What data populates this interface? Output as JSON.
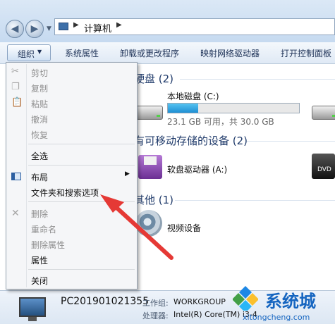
{
  "address": {
    "path": "计算机"
  },
  "toolbar": {
    "organize": "组织",
    "system_properties": "系统属性",
    "uninstall": "卸载或更改程序",
    "map_drive": "映射网络驱动器",
    "open_control_panel": "打开控制面板"
  },
  "groups": {
    "hdd": "硬盘 (2)",
    "removable": "有可移动存储的设备 (2)",
    "other": "其他 (1)"
  },
  "drives": {
    "c_label": "本地磁盘 (C:)",
    "c_free": "23.1 GB 可用，共 30.0 GB",
    "c_used_fraction": 0.23,
    "floppy_label": "软盘驱动器 (A:)",
    "dvd_badge": "DVD",
    "video_label": "视频设备"
  },
  "menu": {
    "cut": "剪切",
    "copy": "复制",
    "paste": "粘贴",
    "undo": "撤消",
    "redo": "恢复",
    "select_all": "全选",
    "layout": "布局",
    "folder_options": "文件夹和搜索选项",
    "delete": "删除",
    "rename": "重命名",
    "remove_properties": "删除属性",
    "properties": "属性",
    "close": "关闭"
  },
  "details": {
    "computer_name": "PC201901021355",
    "workgroup_label": "工作组:",
    "workgroup_value": "WORKGROUP",
    "processor_label": "处理器:",
    "processor_value": "Intel(R) Core(TM) i3-4"
  },
  "watermark": {
    "title": "系统城",
    "url": "xitongcheng.com"
  },
  "colors": {
    "annotation_arrow": "#e53935",
    "watermark": "#1565c0",
    "progress_fill": "#26a0da"
  },
  "icons": {
    "back": "back-arrow-icon",
    "forward": "forward-arrow-icon",
    "layout": "layout-icon",
    "scissors": "scissors-icon",
    "copy": "copy-icon",
    "paste": "paste-icon",
    "delete": "delete-x-icon"
  }
}
